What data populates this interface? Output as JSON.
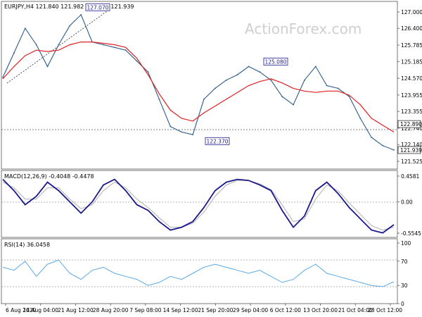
{
  "header": {
    "symbol_info": "EURJPY,H4  121.840 121.982 121.830 121.939",
    "watermark": "ActionForex.com"
  },
  "colors": {
    "price": "#2a5a8a",
    "ma": "#e02020",
    "macd": "#1a1a8c",
    "signal": "#b0b0b0",
    "rsi": "#5aa9e6",
    "grid": "#9a9a9a",
    "flag_bg": "#ffffff",
    "flag_border": "#1a1a8c",
    "flag_text": "#1a1a8c",
    "price_flag_bg": "#ffffff",
    "price_flag_text": "#000000"
  },
  "panels": {
    "price": {
      "ticks": [
        "127.000",
        "126.400",
        "125.785",
        "125.185",
        "124.570",
        "123.955",
        "123.355",
        "122.740",
        "122.140",
        "121.525"
      ],
      "flags": [
        "122.890",
        "121.939"
      ]
    },
    "macd": {
      "label": "MACD(12,26,9) -0.4048 -0.4478",
      "ticks": [
        "0.4581",
        "0.00",
        "-0.5545"
      ]
    },
    "rsi": {
      "label": "RSI(14) 36.0458",
      "ticks": [
        "100",
        "70",
        "30",
        "0"
      ]
    },
    "x_ticks": [
      "6 Aug 2020",
      "14 Aug 04:00",
      "21 Aug 12:00",
      "28 Aug 20:00",
      "7 Sep 08:00",
      "14 Sep 12:00",
      "21 Sep 20:00",
      "29 Sep 04:00",
      "6 Oct 12:00",
      "13 Oct 20:00",
      "21 Oct 04:00",
      "28 Oct 12:00"
    ]
  },
  "chart_data": {
    "type": "line",
    "symbol": "EURJPY",
    "timeframe": "H4",
    "ohlc_last": {
      "open": 121.84,
      "high": 121.982,
      "low": 121.83,
      "close": 121.939
    },
    "ylim": [
      121.525,
      127.0
    ],
    "categories": [
      "6 Aug 2020",
      "14 Aug 04:00",
      "21 Aug 12:00",
      "28 Aug 20:00",
      "7 Sep 08:00",
      "14 Sep 12:00",
      "21 Sep 20:00",
      "29 Sep 04:00",
      "6 Oct 12:00",
      "13 Oct 20:00",
      "21 Oct 04:00",
      "28 Oct 12:00"
    ],
    "series": [
      {
        "name": "EURJPY",
        "values": [
          124.6,
          125.5,
          126.4,
          125.8,
          125.0,
          125.8,
          126.5,
          126.9,
          125.9,
          125.8,
          125.7,
          125.6,
          125.2,
          124.8,
          123.8,
          122.8,
          122.6,
          122.5,
          123.8,
          124.2,
          124.5,
          124.7,
          125.0,
          124.8,
          124.5,
          123.9,
          123.6,
          124.5,
          125.0,
          124.3,
          124.2,
          123.9,
          123.1,
          122.4,
          122.1,
          121.94
        ]
      },
      {
        "name": "MA",
        "values": [
          124.55,
          125.0,
          125.4,
          125.6,
          125.55,
          125.6,
          125.8,
          125.9,
          125.9,
          125.85,
          125.8,
          125.7,
          125.3,
          124.7,
          124.0,
          123.4,
          123.1,
          123.0,
          123.3,
          123.55,
          123.8,
          124.05,
          124.3,
          124.45,
          124.55,
          124.4,
          124.2,
          124.1,
          124.05,
          124.1,
          124.1,
          123.95,
          123.6,
          123.1,
          122.85,
          122.6
        ]
      }
    ],
    "annotations": [
      {
        "label": "127.070",
        "value": 127.07
      },
      {
        "label": "122.370",
        "value": 122.37
      },
      {
        "label": "125.080",
        "value": 125.08
      }
    ],
    "macd": {
      "ylim": [
        -0.5545,
        0.4581
      ],
      "values": [
        0.4,
        0.2,
        -0.05,
        0.1,
        0.35,
        0.2,
        0.0,
        -0.2,
        0.0,
        0.3,
        0.4,
        0.2,
        -0.05,
        -0.15,
        -0.35,
        -0.5,
        -0.45,
        -0.35,
        -0.1,
        0.2,
        0.35,
        0.4,
        0.38,
        0.3,
        0.2,
        -0.15,
        -0.45,
        -0.25,
        0.2,
        0.35,
        0.15,
        -0.1,
        -0.3,
        -0.5,
        -0.55,
        -0.4048
      ],
      "signal": [
        0.35,
        0.25,
        0.05,
        0.05,
        0.25,
        0.25,
        0.05,
        -0.12,
        -0.05,
        0.2,
        0.35,
        0.25,
        0.05,
        -0.1,
        -0.28,
        -0.45,
        -0.45,
        -0.38,
        -0.18,
        0.1,
        0.3,
        0.38,
        0.38,
        0.32,
        0.22,
        -0.05,
        -0.35,
        -0.3,
        0.05,
        0.3,
        0.2,
        -0.02,
        -0.22,
        -0.42,
        -0.5,
        -0.4478
      ]
    },
    "rsi": {
      "ylim": [
        0,
        100
      ],
      "levels": [
        70,
        30
      ],
      "values": [
        60,
        55,
        70,
        45,
        65,
        72,
        50,
        40,
        55,
        60,
        50,
        45,
        40,
        30,
        35,
        45,
        40,
        50,
        60,
        65,
        60,
        55,
        50,
        55,
        45,
        35,
        40,
        55,
        65,
        50,
        45,
        40,
        35,
        30,
        28,
        36.0458
      ]
    }
  }
}
